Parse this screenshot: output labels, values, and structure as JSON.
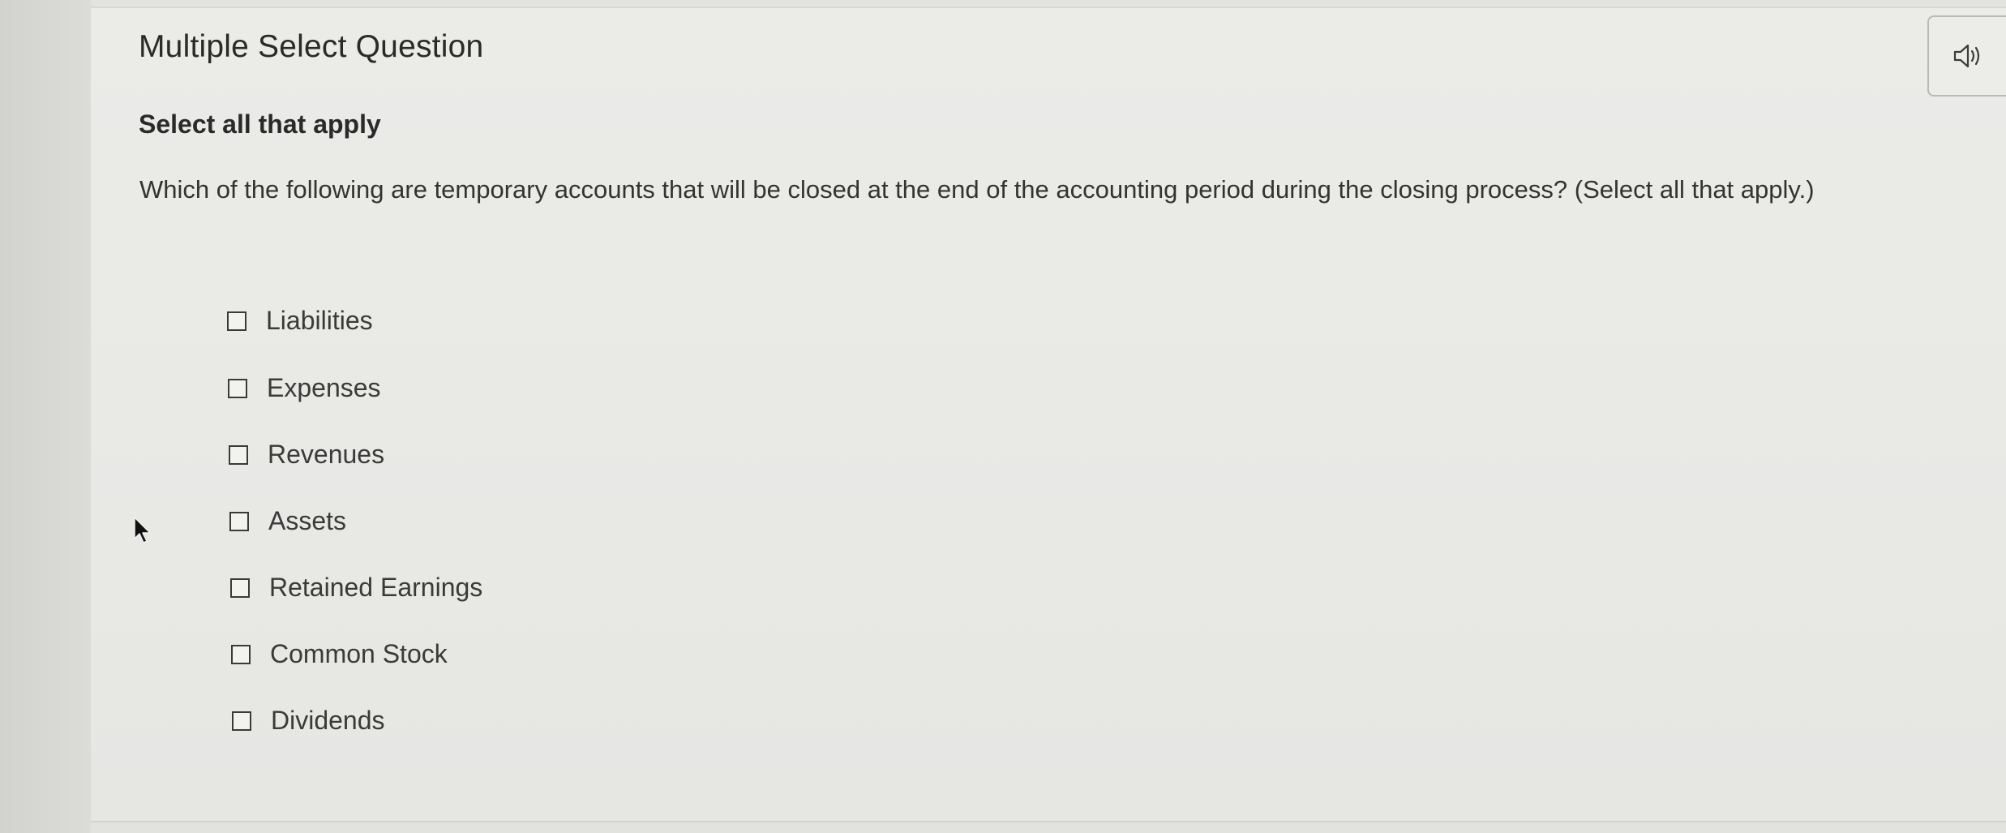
{
  "header": {
    "title": "Multiple Select Question",
    "audio_icon": "speaker-icon"
  },
  "instructions": "Select all that apply",
  "question": "Which of the following are temporary accounts that will be closed at the end of the accounting period during the closing process? (Select all that apply.)",
  "options": [
    {
      "label": "Liabilities",
      "checked": false
    },
    {
      "label": "Expenses",
      "checked": false
    },
    {
      "label": "Revenues",
      "checked": false
    },
    {
      "label": "Assets",
      "checked": false
    },
    {
      "label": "Retained Earnings",
      "checked": false
    },
    {
      "label": "Common Stock",
      "checked": false
    },
    {
      "label": "Dividends",
      "checked": false
    }
  ]
}
